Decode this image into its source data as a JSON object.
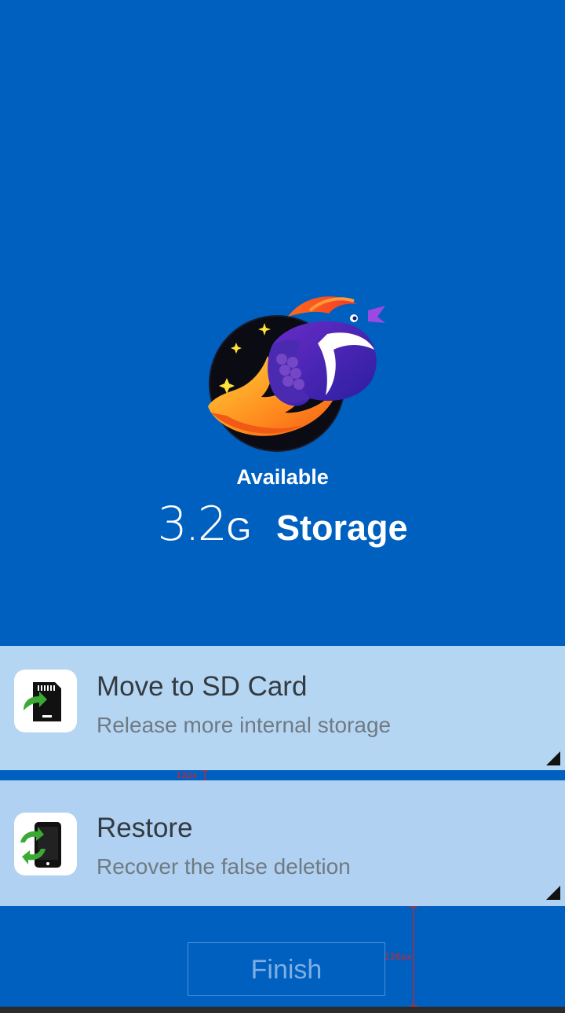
{
  "hero": {
    "logo": "rocket-bird-logo-icon",
    "available_label": "Available",
    "storage_value": "3.2",
    "storage_unit": "G",
    "storage_label": "Storage"
  },
  "options": {
    "move": {
      "icon": "sd-card-move-icon",
      "title": "Move to SD Card",
      "subtitle": "Release more internal storage"
    },
    "restore": {
      "icon": "phone-restore-icon",
      "title": "Restore",
      "subtitle": "Recover the false deletion"
    }
  },
  "footer": {
    "finish_label": "Finish"
  },
  "annotations": {
    "gap_label": "12px",
    "bottom_label": "126px"
  },
  "colors": {
    "background": "#0060C0",
    "card": "#B5D6F3",
    "card_alt": "#B0D1F1",
    "accent_green": "#3BAA35",
    "text_dark": "#333A40",
    "text_muted": "#707A82",
    "measure_red": "#E0201C"
  }
}
